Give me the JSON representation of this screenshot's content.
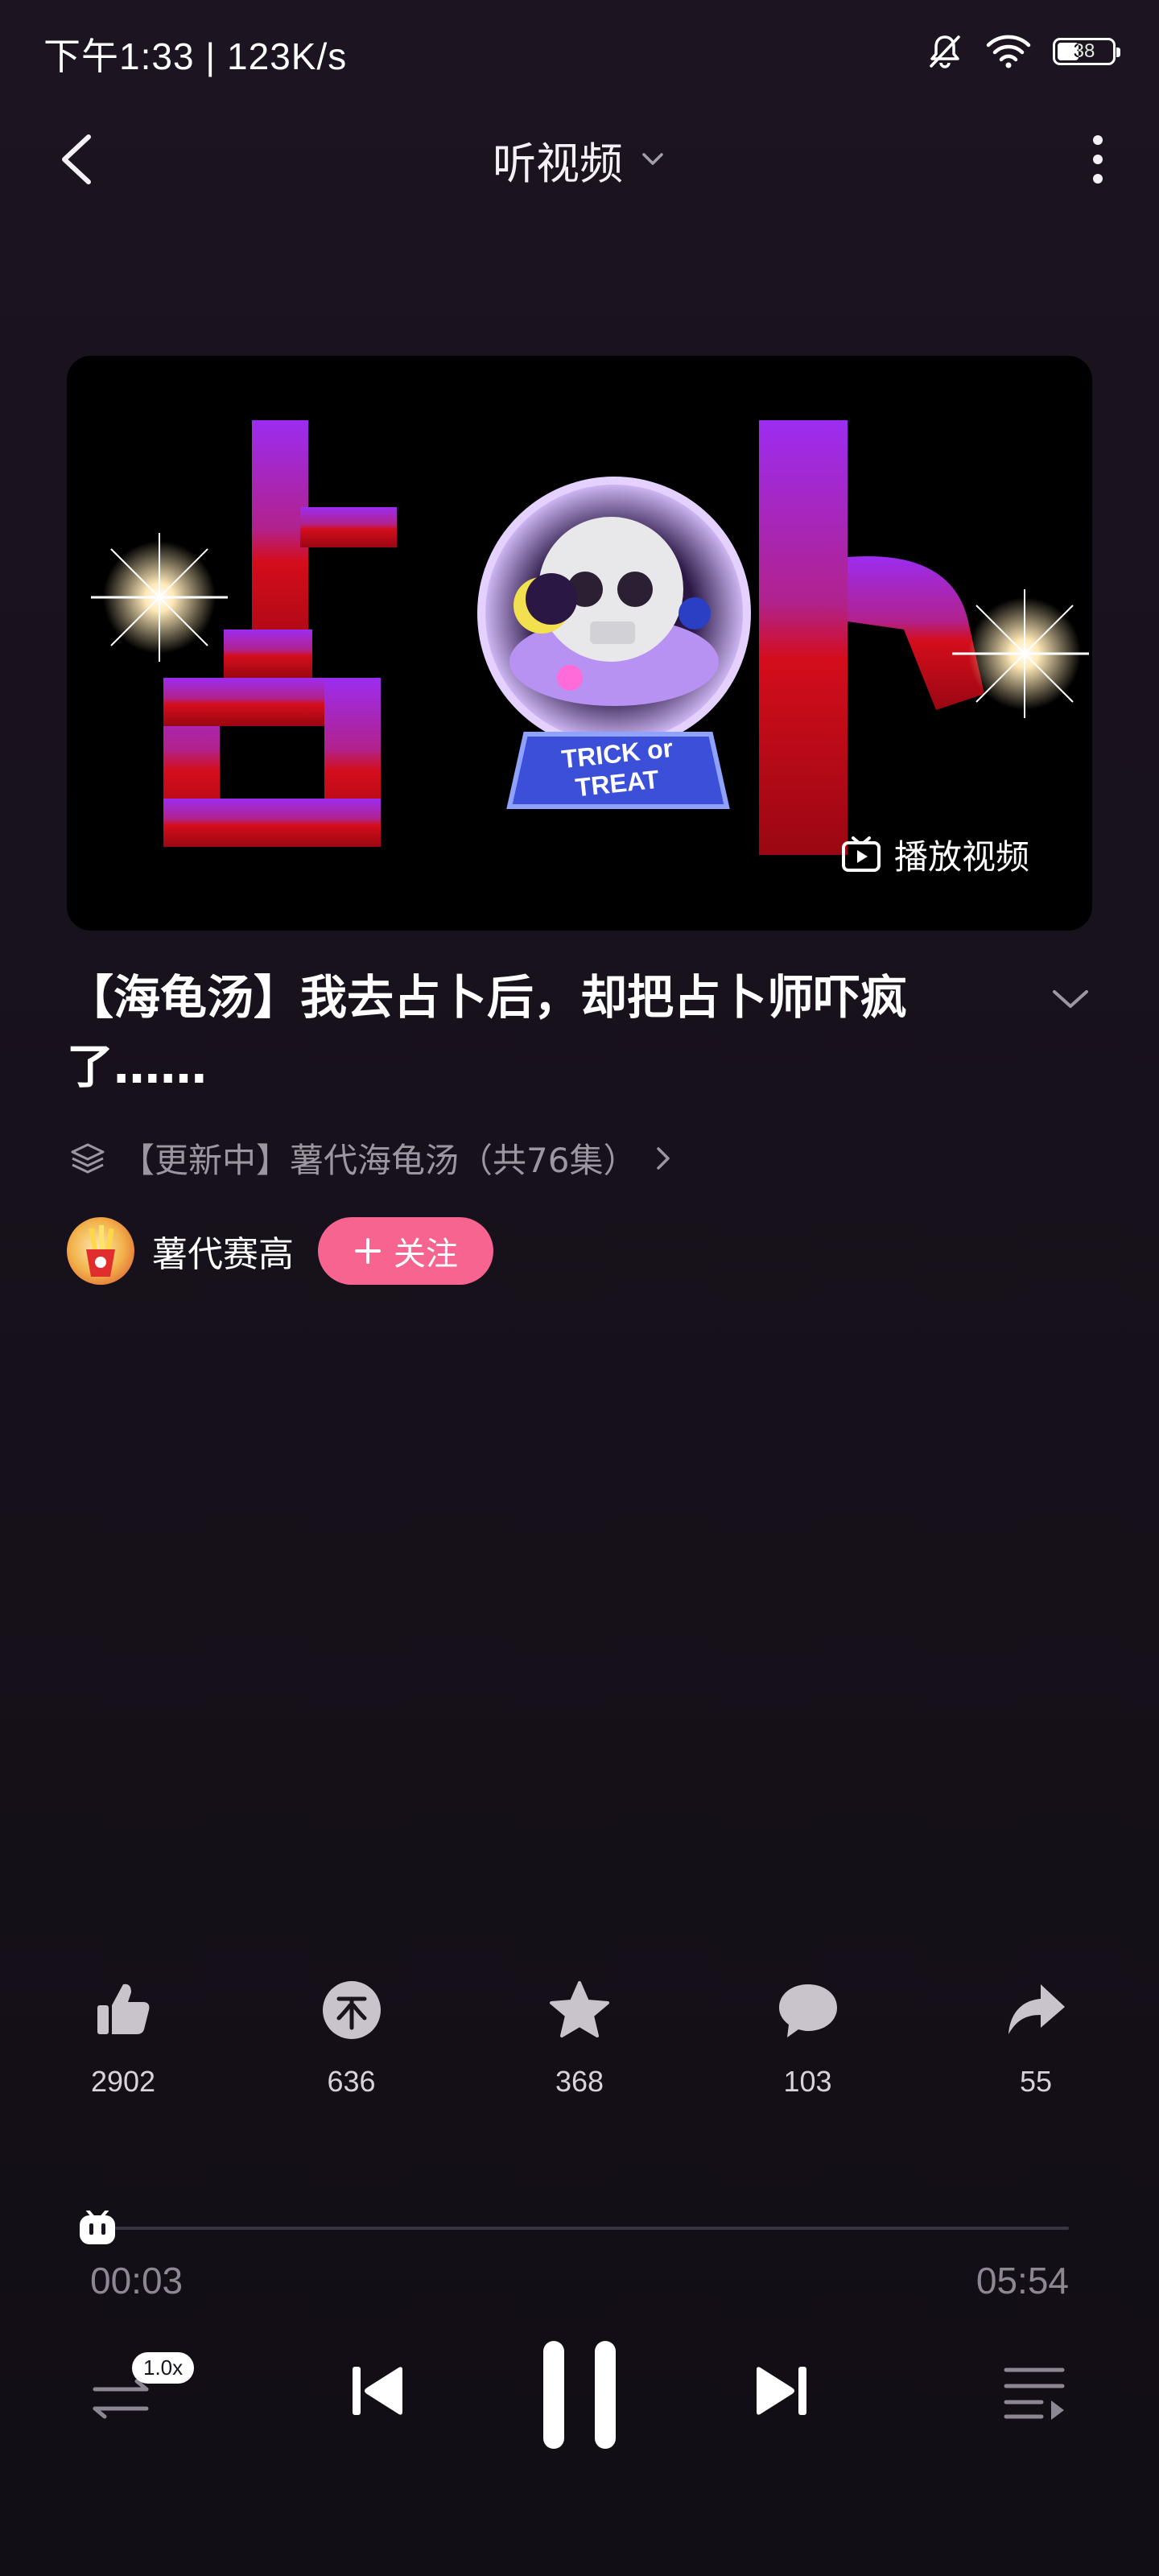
{
  "status_bar": {
    "time": "下午1:33 | 123K/s",
    "battery": "38"
  },
  "nav": {
    "title": "听视频"
  },
  "cover": {
    "play_video_label": "播放视频",
    "badge_text": "TRICK or TREAT"
  },
  "video": {
    "title": "【海龟汤】我去占卜后，却把占卜师吓疯了……"
  },
  "collection": {
    "label": "【更新中】薯代海龟汤（共76集）"
  },
  "author": {
    "name": "薯代赛高",
    "follow_label": "关注"
  },
  "actions": {
    "like": "2902",
    "coin": "636",
    "favorite": "368",
    "comment": "103",
    "share": "55"
  },
  "player": {
    "current_time": "00:03",
    "total_time": "05:54",
    "progress_fraction": 0.009,
    "speed": "1.0x"
  },
  "colors": {
    "accent_pink": "#f6648f",
    "background": "#17111b"
  }
}
